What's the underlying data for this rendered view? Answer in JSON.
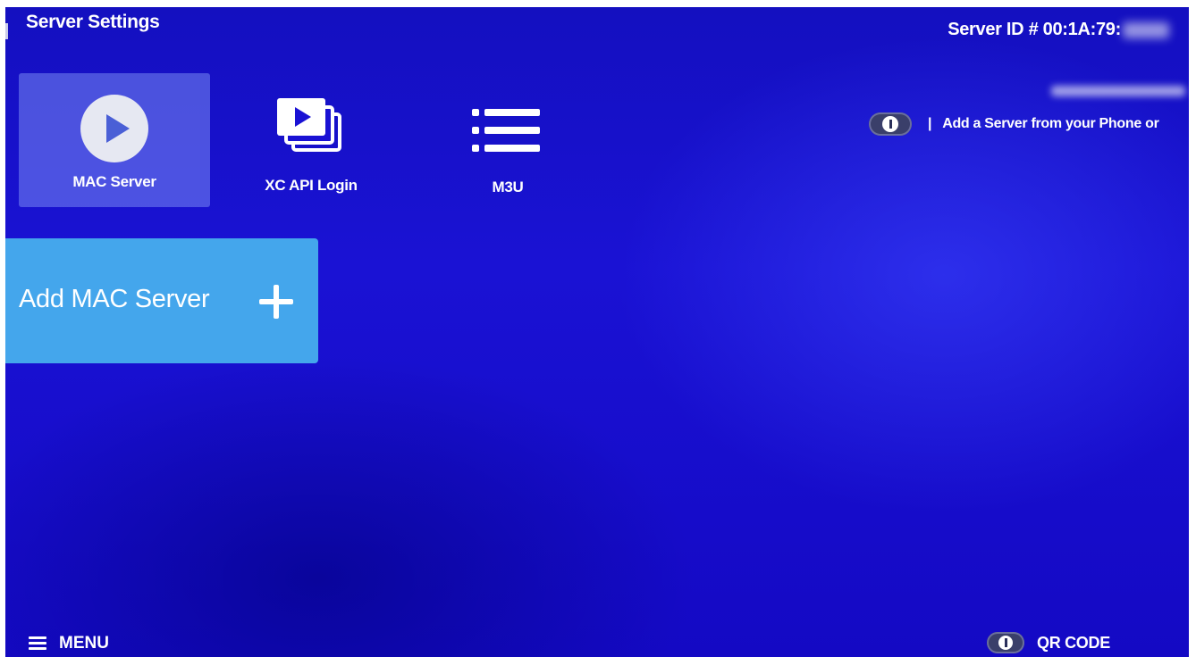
{
  "header": {
    "title": "Server Settings",
    "server_id_label": "Server ID # 00:1A:79:"
  },
  "add_server_hint": {
    "separator": "|",
    "text": "Add a Server from your Phone or",
    "button_icon": "remote-option-button-icon"
  },
  "tabs": [
    {
      "label": "MAC Server",
      "icon": "play-circle-icon",
      "selected": true
    },
    {
      "label": "XC API Login",
      "icon": "stacked-play-icon",
      "selected": false
    },
    {
      "label": "M3U",
      "icon": "list-icon",
      "selected": false
    }
  ],
  "add_card": {
    "label": "Add MAC Server",
    "icon": "plus-icon"
  },
  "footer": {
    "menu_label": "MENU",
    "menu_icon": "hamburger-icon",
    "qr_label": "QR CODE",
    "qr_icon": "remote-option-button-icon"
  },
  "colors": {
    "background": "#1a12d4",
    "selected_tile": "#7f8ff0",
    "add_card": "#44a6ec",
    "text": "#ffffff"
  }
}
